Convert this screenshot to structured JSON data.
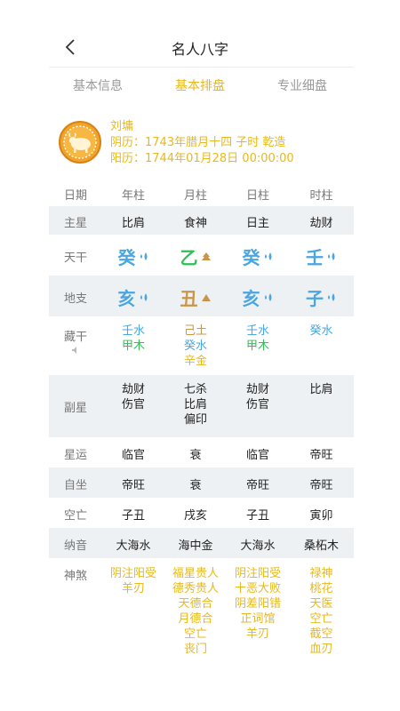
{
  "header": {
    "title": "名人八字"
  },
  "tabs": [
    {
      "label": "基本信息",
      "active": false
    },
    {
      "label": "基本排盘",
      "active": true
    },
    {
      "label": "专业细盘",
      "active": false
    }
  ],
  "profile": {
    "name": "刘墉",
    "lunar": "阴历：1743年腊月十四 子时 乾造",
    "solar": "阳历：1744年01月28日 00:00:00",
    "avatar_icon": "ox-zodiac-icon"
  },
  "colors": {
    "accent": "#e8b81e",
    "water": "#4aa6e0",
    "wood": "#2fbf55",
    "earth": "#c9954b",
    "shade": "#eef1f4"
  },
  "table": {
    "headers": [
      "日期",
      "年柱",
      "月柱",
      "日柱",
      "时柱"
    ],
    "zhuxing": {
      "label": "主星",
      "values": [
        "比肩",
        "食神",
        "日主",
        "劫财"
      ]
    },
    "tiangan": {
      "label": "天干",
      "values": [
        {
          "char": "癸",
          "element": "water",
          "icon": "water-drop-icon"
        },
        {
          "char": "乙",
          "element": "wood",
          "icon": "wood-icon"
        },
        {
          "char": "癸",
          "element": "water",
          "icon": "water-drop-icon"
        },
        {
          "char": "壬",
          "element": "water",
          "icon": "water-drop-icon"
        }
      ]
    },
    "dizhi": {
      "label": "地支",
      "values": [
        {
          "char": "亥",
          "element": "water",
          "icon": "water-drop-icon"
        },
        {
          "char": "丑",
          "element": "earth",
          "icon": "earth-icon"
        },
        {
          "char": "亥",
          "element": "water",
          "icon": "water-drop-icon"
        },
        {
          "char": "子",
          "element": "water",
          "icon": "water-drop-icon"
        }
      ]
    },
    "canggan": {
      "label": "藏干",
      "values": [
        [
          {
            "text": "壬水",
            "element": "water"
          },
          {
            "text": "甲木",
            "element": "wood"
          }
        ],
        [
          {
            "text": "己土",
            "element": "earth"
          },
          {
            "text": "癸水",
            "element": "water"
          },
          {
            "text": "辛金",
            "element": "metal"
          }
        ],
        [
          {
            "text": "壬水",
            "element": "water"
          },
          {
            "text": "甲木",
            "element": "wood"
          }
        ],
        [
          {
            "text": "癸水",
            "element": "water"
          }
        ]
      ]
    },
    "fuxing": {
      "label": "副星",
      "values": [
        [
          "劫财",
          "伤官"
        ],
        [
          "七杀",
          "比肩",
          "偏印"
        ],
        [
          "劫财",
          "伤官"
        ],
        [
          "比肩"
        ]
      ]
    },
    "xingyun": {
      "label": "星运",
      "values": [
        "临官",
        "衰",
        "临官",
        "帝旺"
      ]
    },
    "zizuo": {
      "label": "自坐",
      "values": [
        "帝旺",
        "衰",
        "帝旺",
        "帝旺"
      ]
    },
    "kongwang": {
      "label": "空亡",
      "values": [
        "子丑",
        "戌亥",
        "子丑",
        "寅卯"
      ]
    },
    "nayin": {
      "label": "纳音",
      "values": [
        "大海水",
        "海中金",
        "大海水",
        "桑柘木"
      ]
    },
    "shensha": {
      "label": "神煞",
      "values": [
        [
          "阴注阳受",
          "羊刃"
        ],
        [
          "福星贵人",
          "德秀贵人",
          "天德合",
          "月德合",
          "空亡",
          "丧门"
        ],
        [
          "阴注阳受",
          "十恶大败",
          "阴差阳错",
          "正词馆",
          "羊刃"
        ],
        [
          "禄神",
          "桃花",
          "天医",
          "空亡",
          "截空",
          "血刃"
        ]
      ]
    }
  }
}
